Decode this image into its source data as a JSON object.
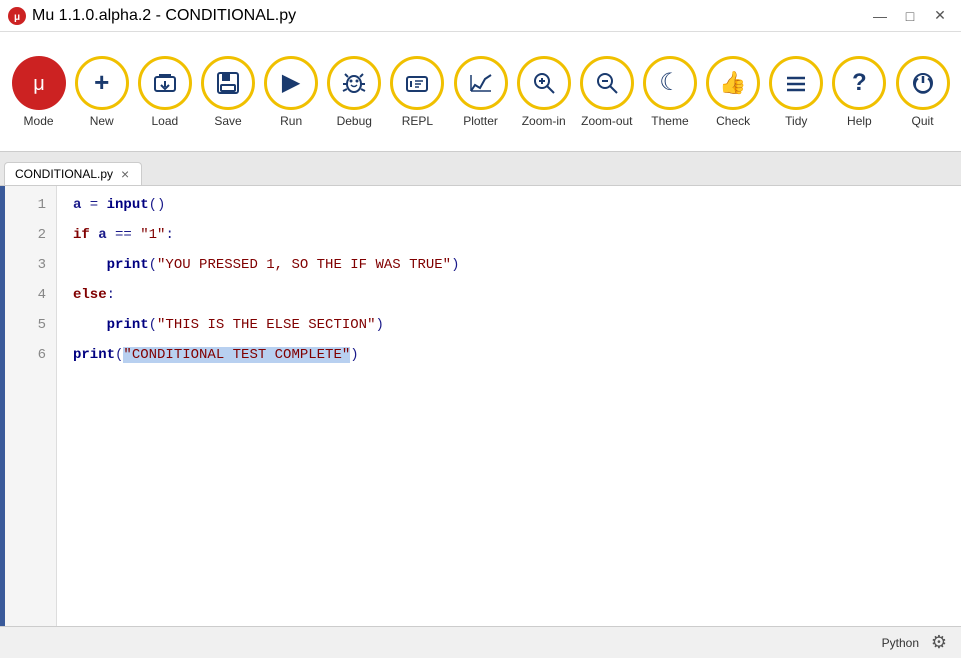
{
  "titlebar": {
    "logo": "mu-logo",
    "title": "Mu 1.1.0.alpha.2 - CONDITIONAL.py",
    "controls": {
      "minimize": "—",
      "maximize": "□",
      "close": "✕"
    }
  },
  "toolbar": {
    "buttons": [
      {
        "id": "mode",
        "label": "Mode",
        "icon": "🐍",
        "circle": false
      },
      {
        "id": "new",
        "label": "New",
        "icon": "✚",
        "circle": true
      },
      {
        "id": "load",
        "label": "Load",
        "icon": "📂",
        "circle": true
      },
      {
        "id": "save",
        "label": "Save",
        "icon": "💾",
        "circle": true
      },
      {
        "id": "run",
        "label": "Run",
        "icon": "▶",
        "circle": true
      },
      {
        "id": "debug",
        "label": "Debug",
        "icon": "🐞",
        "circle": true
      },
      {
        "id": "repl",
        "label": "REPL",
        "icon": "⌨",
        "circle": true
      },
      {
        "id": "plotter",
        "label": "Plotter",
        "icon": "📈",
        "circle": true
      },
      {
        "id": "zoom-in",
        "label": "Zoom-in",
        "icon": "🔍",
        "circle": true
      },
      {
        "id": "zoom-out",
        "label": "Zoom-out",
        "icon": "🔎",
        "circle": true
      },
      {
        "id": "theme",
        "label": "Theme",
        "icon": "☾",
        "circle": true
      },
      {
        "id": "check",
        "label": "Check",
        "icon": "👍",
        "circle": true
      },
      {
        "id": "tidy",
        "label": "Tidy",
        "icon": "≡",
        "circle": true
      },
      {
        "id": "help",
        "label": "Help",
        "icon": "?",
        "circle": true
      },
      {
        "id": "quit",
        "label": "Quit",
        "icon": "⏻",
        "circle": true
      }
    ]
  },
  "tab": {
    "filename": "CONDITIONAL.py",
    "close_label": "×"
  },
  "editor": {
    "lines": [
      {
        "num": "1",
        "content": "a = input()"
      },
      {
        "num": "2",
        "content": "if a == \"1\":"
      },
      {
        "num": "3",
        "content": "    print(\"YOU PRESSED 1, SO THE IF WAS TRUE\")"
      },
      {
        "num": "4",
        "content": "else:"
      },
      {
        "num": "5",
        "content": "    print(\"THIS IS THE ELSE SECTION\")"
      },
      {
        "num": "6",
        "content": "print(\"CONDITIONAL TEST COMPLETE\")"
      }
    ]
  },
  "statusbar": {
    "mode": "Python",
    "gear_icon": "⚙"
  }
}
